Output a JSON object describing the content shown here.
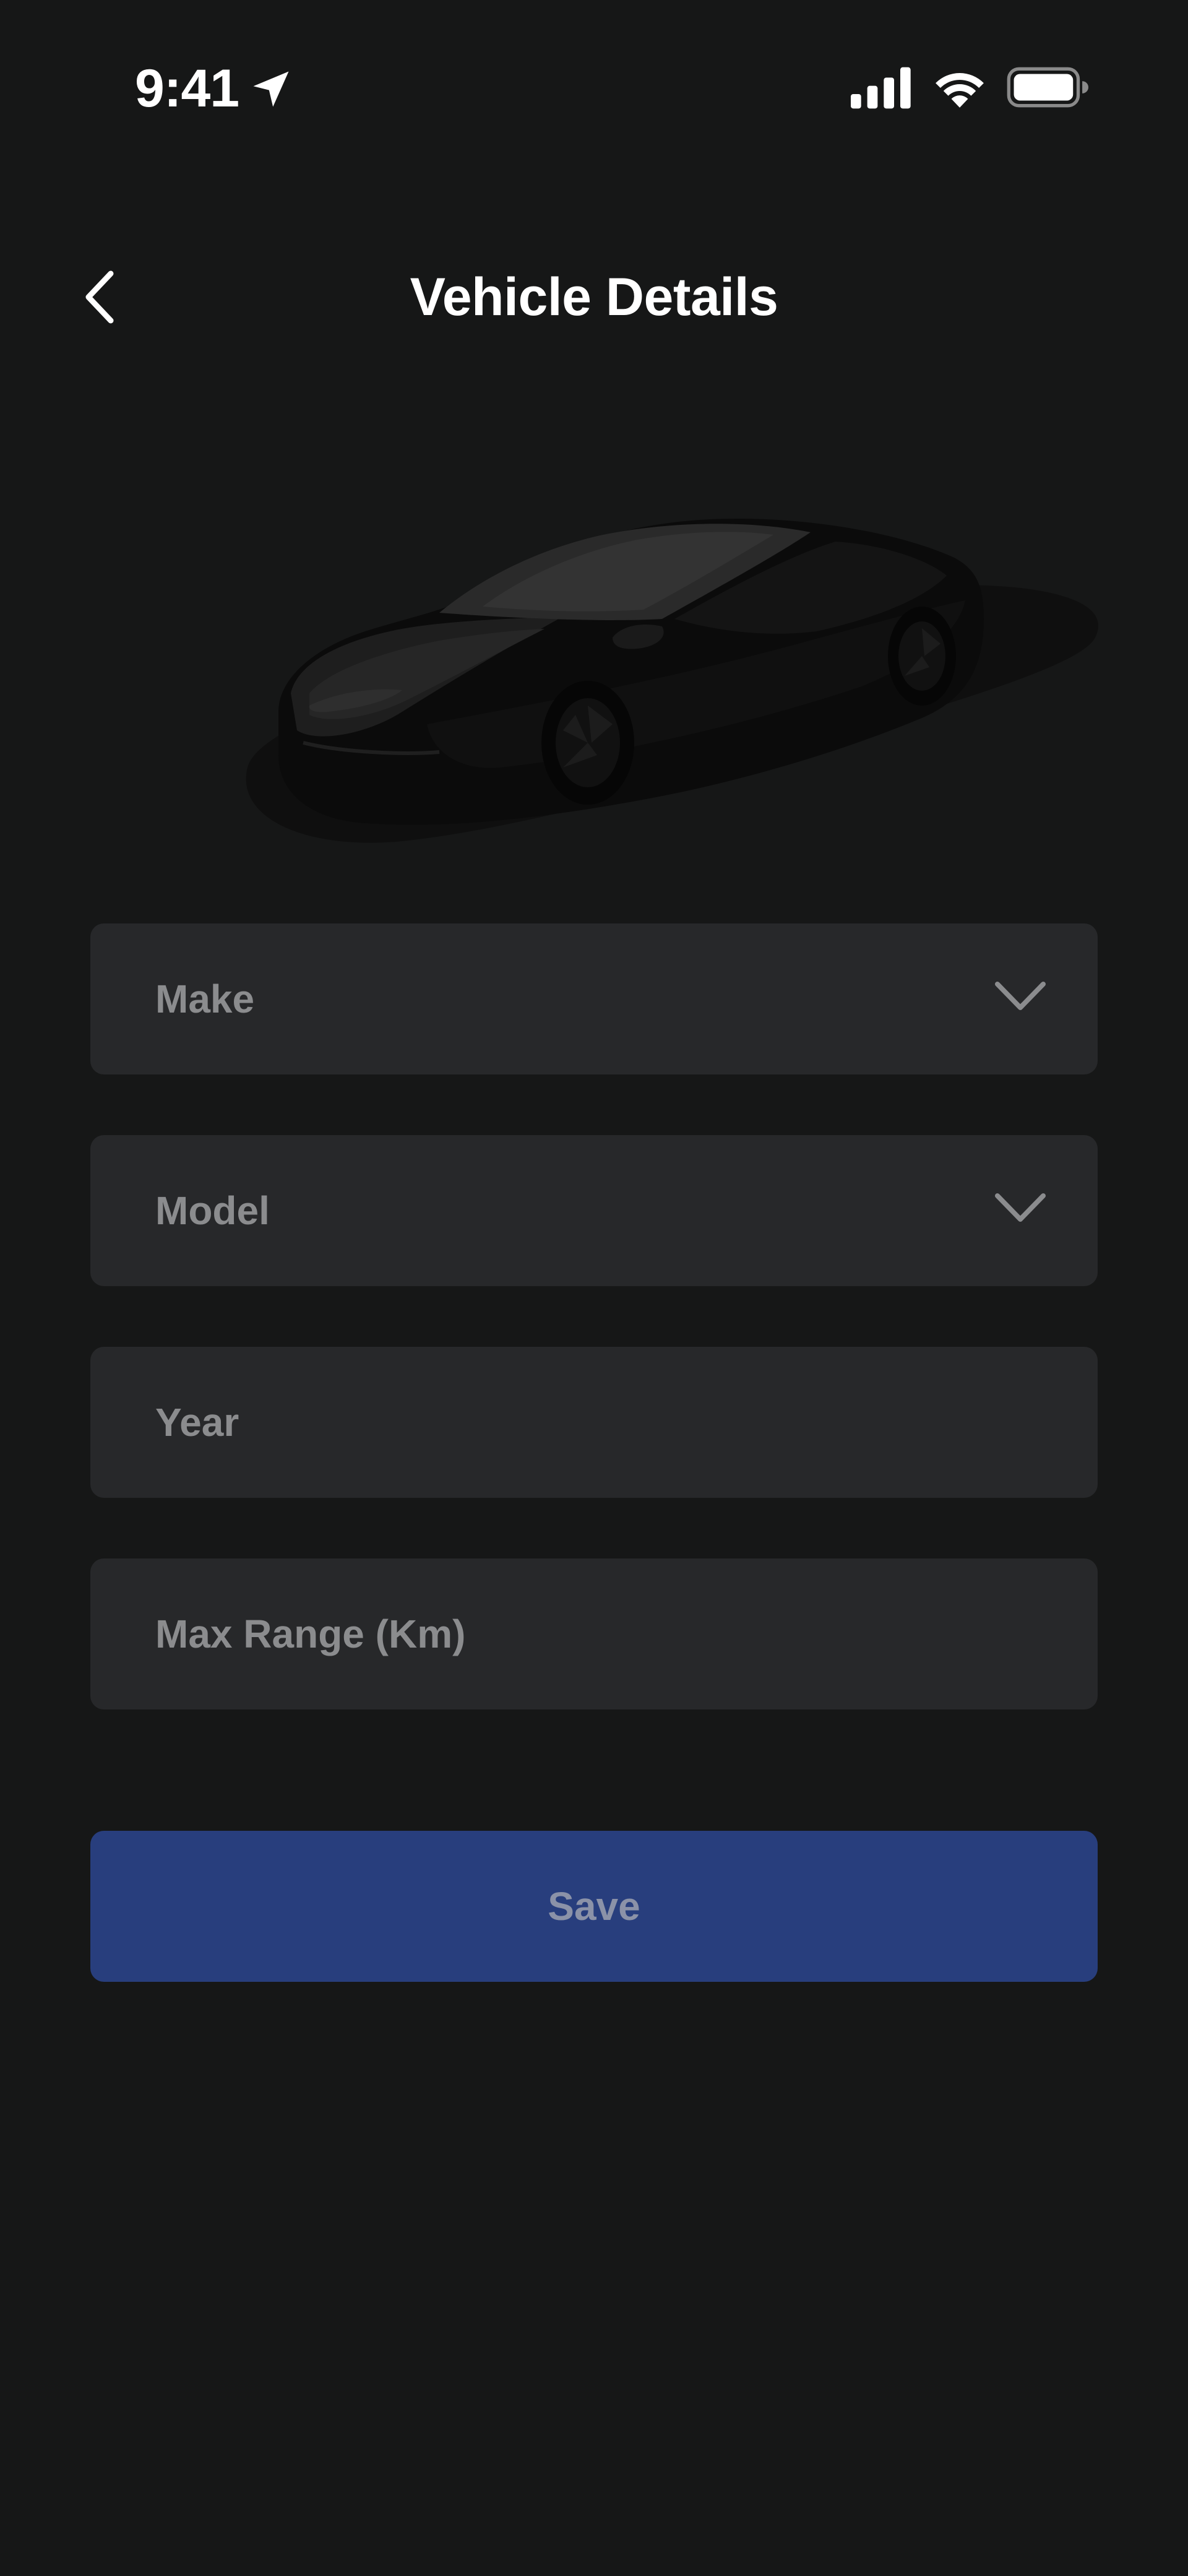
{
  "status_bar": {
    "time": "9:41",
    "icons": [
      "location-arrow-icon",
      "cellular-signal-icon",
      "wifi-icon",
      "battery-icon"
    ]
  },
  "header": {
    "title": "Vehicle Details",
    "back_icon": "chevron-left-icon"
  },
  "vehicle_image": {
    "icon": "car-illustration"
  },
  "form": {
    "make": {
      "placeholder": "Make",
      "value": "",
      "icon": "chevron-down-icon"
    },
    "model": {
      "placeholder": "Model",
      "value": "",
      "icon": "chevron-down-icon"
    },
    "year": {
      "placeholder": "Year",
      "value": ""
    },
    "max_range": {
      "placeholder": "Max Range (Km)",
      "value": ""
    }
  },
  "actions": {
    "save_label": "Save"
  },
  "colors": {
    "background": "#161717",
    "field_background": "#27282a",
    "placeholder_text": "#8b8c8e",
    "primary_button": "#283e7d",
    "primary_button_text": "#8b92a8",
    "text": "#ffffff"
  }
}
